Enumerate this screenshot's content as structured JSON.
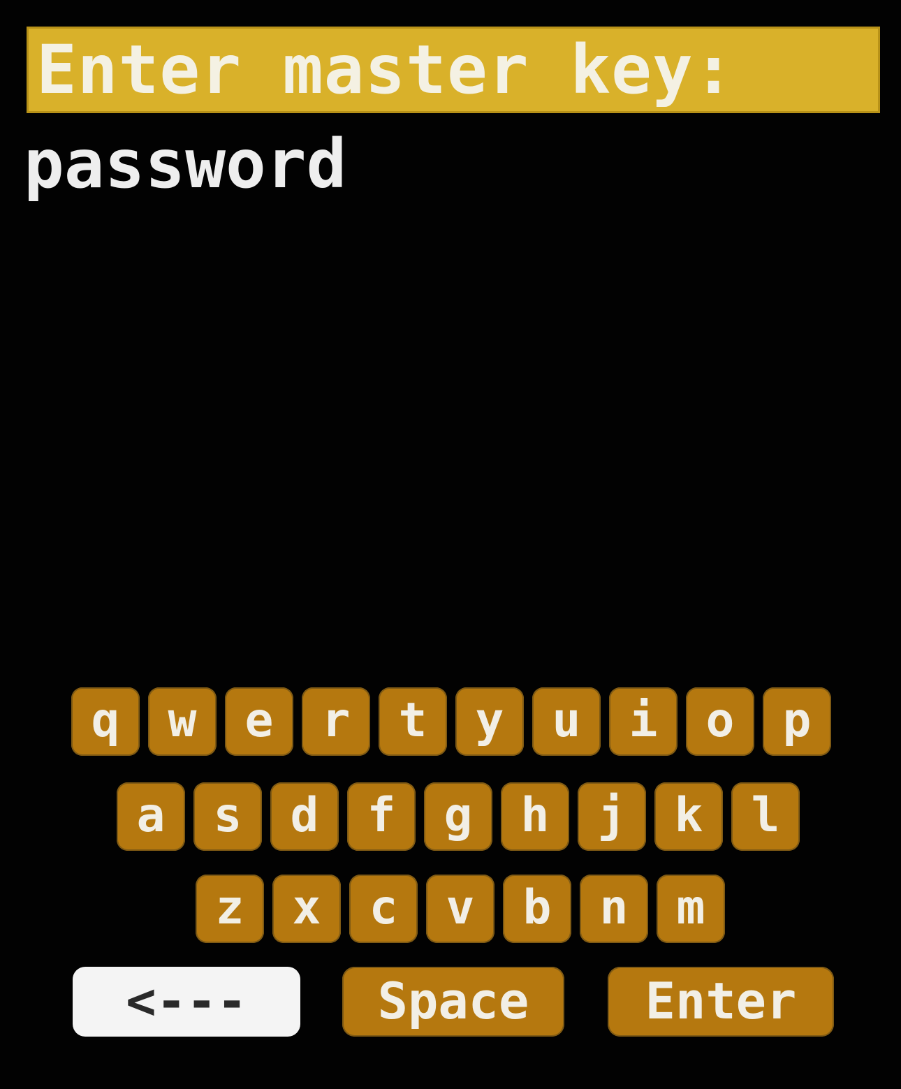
{
  "header": {
    "title": "Enter master key:"
  },
  "input": {
    "value": "password"
  },
  "keyboard": {
    "rows": [
      [
        "q",
        "w",
        "e",
        "r",
        "t",
        "y",
        "u",
        "i",
        "o",
        "p"
      ],
      [
        "a",
        "s",
        "d",
        "f",
        "g",
        "h",
        "j",
        "k",
        "l"
      ],
      [
        "z",
        "x",
        "c",
        "v",
        "b",
        "n",
        "m"
      ]
    ],
    "backspace_label": "<---",
    "space_label": "Space",
    "enter_label": "Enter"
  },
  "colors": {
    "title_bar": "#d9b12a",
    "key": "#b5780f",
    "backspace_key": "#f4f4f4",
    "background": "#000000"
  }
}
